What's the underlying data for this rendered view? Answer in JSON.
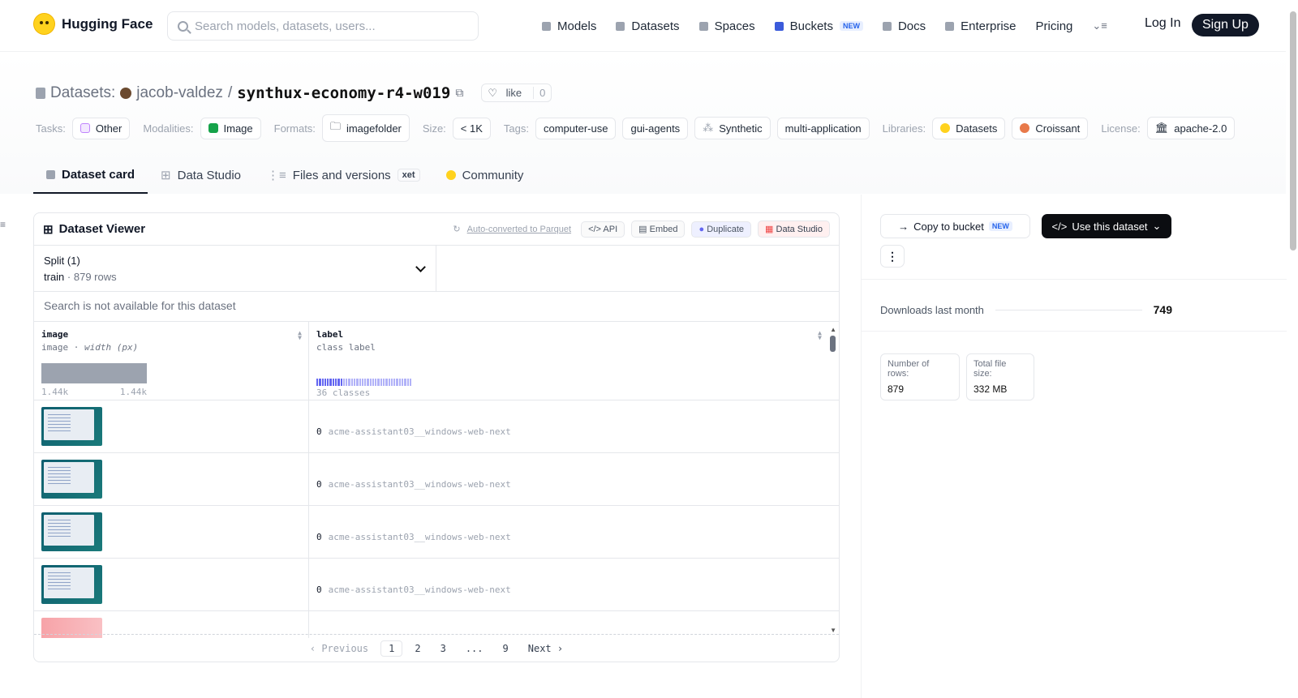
{
  "nav": {
    "brand": "Hugging Face",
    "search_placeholder": "Search models, datasets, users...",
    "links": [
      "Models",
      "Datasets",
      "Spaces",
      "Buckets",
      "Docs",
      "Enterprise",
      "Pricing"
    ],
    "new_badge": "NEW",
    "login": "Log In",
    "signup": "Sign Up"
  },
  "header": {
    "crumb": "Datasets:",
    "owner": "jacob-valdez",
    "sep": "/",
    "name": "synthux-economy-r4-w019",
    "like_label": "like",
    "like_count": "0"
  },
  "tags": {
    "tasks_label": "Tasks:",
    "task": "Other",
    "modalities_label": "Modalities:",
    "modality": "Image",
    "formats_label": "Formats:",
    "format": "imagefolder",
    "size_label": "Size:",
    "size": "< 1K",
    "tags_label": "Tags:",
    "tag_values": [
      "computer-use",
      "gui-agents",
      "Synthetic",
      "multi-application"
    ],
    "libraries_label": "Libraries:",
    "libraries": [
      "Datasets",
      "Croissant"
    ],
    "license_label": "License:",
    "license": "apache-2.0"
  },
  "tabs": [
    "Dataset card",
    "Data Studio",
    "Files and versions",
    "Community"
  ],
  "xet_badge": "xet",
  "viewer": {
    "title": "Dataset Viewer",
    "auto_converted": "Auto-converted to Parquet",
    "api": "API",
    "embed": "Embed",
    "duplicate": "Duplicate",
    "data_studio": "Data Studio",
    "split_label": "Split (1)",
    "split_name": "train",
    "split_rows": "879 rows",
    "search_na": "Search is not available for this dataset",
    "columns": [
      {
        "name": "image",
        "type": "image",
        "subtype": "width (px)",
        "min": "1.44k",
        "max": "1.44k"
      },
      {
        "name": "label",
        "type": "class label",
        "classes": "36 classes"
      }
    ],
    "rows": [
      {
        "label_id": "0",
        "label_name": "acme-assistant03__windows-web-next"
      },
      {
        "label_id": "0",
        "label_name": "acme-assistant03__windows-web-next"
      },
      {
        "label_id": "0",
        "label_name": "acme-assistant03__windows-web-next"
      },
      {
        "label_id": "0",
        "label_name": "acme-assistant03__windows-web-next"
      }
    ],
    "pager": {
      "prev": "Previous",
      "pages": [
        "1",
        "2",
        "3",
        "...",
        "9"
      ],
      "next": "Next"
    }
  },
  "sidebar": {
    "copy_to_bucket": "Copy to bucket",
    "use_dataset": "Use this dataset",
    "downloads_label": "Downloads last month",
    "downloads": "749",
    "rows_label": "Number of rows:",
    "rows_value": "879",
    "size_label": "Total file size:",
    "size_value": "332 MB"
  },
  "colors": {
    "accent": "#6366f1",
    "dark": "#111827",
    "brand_yellow": "#ffd21e"
  }
}
